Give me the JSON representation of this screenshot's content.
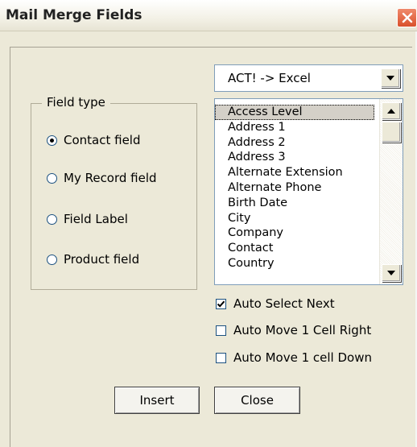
{
  "window": {
    "title": "Mail Merge Fields"
  },
  "format_select": {
    "value": "ACT! -> Excel"
  },
  "field_type": {
    "legend": "Field type",
    "options": [
      {
        "label": "Contact field",
        "selected": true
      },
      {
        "label": "My Record field",
        "selected": false
      },
      {
        "label": "Field Label",
        "selected": false
      },
      {
        "label": "Product field",
        "selected": false
      }
    ]
  },
  "fields_list": {
    "items": [
      "Access Level",
      "Address 1",
      "Address 2",
      "Address 3",
      "Alternate Extension",
      "Alternate Phone",
      "Birth Date",
      "City",
      "Company",
      "Contact",
      "Country"
    ],
    "selected_index": 0
  },
  "options": [
    {
      "label": "Auto Select Next",
      "checked": true
    },
    {
      "label": "Auto Move 1 Cell Right",
      "checked": false
    },
    {
      "label": "Auto Move 1 cell Down",
      "checked": false
    }
  ],
  "buttons": {
    "insert": "Insert",
    "close": "Close"
  },
  "colors": {
    "dialog_bg": "#ece9d8",
    "close_button": "#d9502c",
    "radio_dot": "#21a121"
  }
}
